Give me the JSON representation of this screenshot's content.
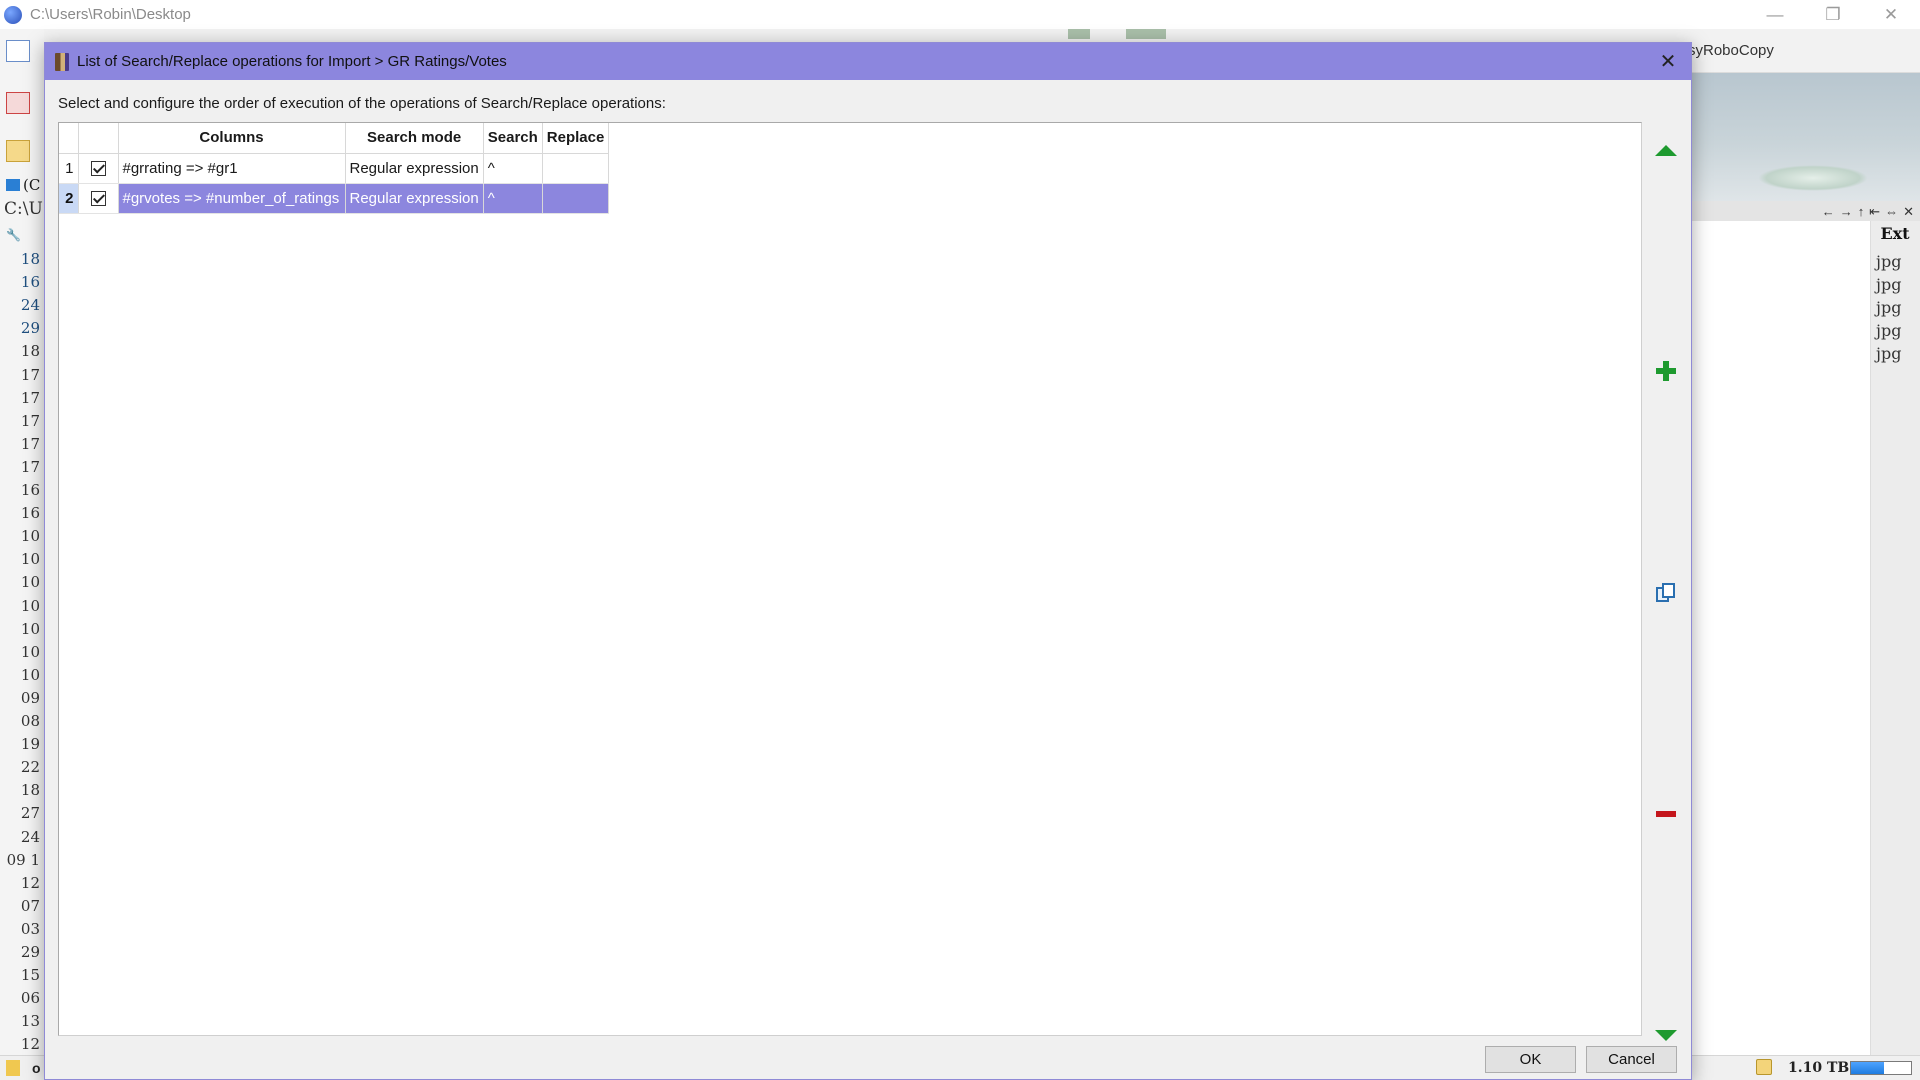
{
  "background": {
    "window_path": "C:\\Users\\Robin\\Desktop",
    "right_panel_label": "syRoboCopy",
    "left_path_fragment": "C:\\U",
    "left_tab_fragment": "(C",
    "left_numbers": [
      "18",
      "16",
      "24",
      "29",
      "18",
      "17",
      "17",
      "17",
      "17",
      "17",
      "16",
      "16",
      "10",
      "10",
      "10",
      "10",
      "10",
      "10",
      "10",
      "09",
      "08",
      "19",
      "22",
      "18",
      "27",
      "24",
      "09 1",
      "12",
      "07",
      "03",
      "29",
      "15",
      "06",
      "13",
      "12"
    ],
    "ext_header": "Ext",
    "ext_items": [
      "jpg",
      "jpg",
      "jpg",
      "jpg",
      "jpg"
    ],
    "status_left": "o",
    "disk_size": "1.10 TB",
    "disk_fill_fraction": 0.55,
    "nav_glyphs": [
      "←",
      "→",
      "↑",
      "⇤",
      "⇔",
      "✕"
    ]
  },
  "dialog": {
    "title": "List of Search/Replace operations for Import > GR Ratings/Votes",
    "close_glyph": "✕",
    "instructions": "Select and configure the order of execution of the operations of Search/Replace operations:",
    "columns": [
      "",
      "",
      "Columns",
      "Search mode",
      "Search",
      "Replace"
    ],
    "rows": [
      {
        "num": "1",
        "checked": true,
        "columns": "#grrating => #gr1",
        "search_mode": "Regular expression",
        "search": "^",
        "replace": ""
      },
      {
        "num": "2",
        "checked": true,
        "columns": "#grvotes => #number_of_ratings",
        "search_mode": "Regular expression",
        "search": "^",
        "replace": ""
      }
    ],
    "selected_row": 2,
    "side_buttons": [
      "move-up",
      "add",
      "copy",
      "remove",
      "move-down"
    ],
    "ok_label": "OK",
    "cancel_label": "Cancel",
    "colors": {
      "accent": "#8c86de",
      "add": "#1e9a2f",
      "remove": "#c4161c"
    }
  }
}
